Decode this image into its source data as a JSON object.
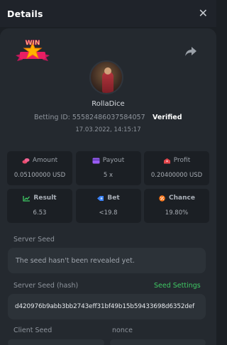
{
  "header": {
    "title": "Details",
    "close_icon": "close-icon"
  },
  "badge": {
    "text": "WIN"
  },
  "user": {
    "name": "RollaDice",
    "betting_id": "Betting ID: 55582486037584057",
    "verified": "Verified",
    "date": "17.03.2022, 14:15:17"
  },
  "stats": [
    {
      "label": "Amount",
      "value": "0.05100000 USD",
      "icon": "coins-icon",
      "color": "#e84b6b"
    },
    {
      "label": "Payout",
      "value": "5 x",
      "icon": "card-icon",
      "color": "#9b5cf6"
    },
    {
      "label": "Profit",
      "value": "0.20400000 USD",
      "icon": "chest-icon",
      "color": "#e5484d"
    },
    {
      "label": "Result",
      "value": "6.53",
      "icon": "chart-icon",
      "color": "#3fc964"
    },
    {
      "label": "Bet",
      "value": "<19.8",
      "icon": "target-icon",
      "color": "#3b82f6"
    },
    {
      "label": "Chance",
      "value": "19.80%",
      "icon": "percent-icon",
      "color": "#f97316"
    }
  ],
  "server_seed": {
    "label": "Server Seed",
    "value": "The seed hasn't been revealed yet."
  },
  "server_seed_hash": {
    "label": "Server Seed (hash)",
    "settings_link": "Seed Settings",
    "value": "d420976b9abb3bb2743eff31bf49b15b59433698d6352def"
  },
  "client_seed": {
    "label": "Client Seed"
  },
  "nonce": {
    "label": "nonce"
  },
  "colors": {
    "accent_green": "#3fc964",
    "background": "#1b1f24",
    "panel": "#24292f"
  }
}
